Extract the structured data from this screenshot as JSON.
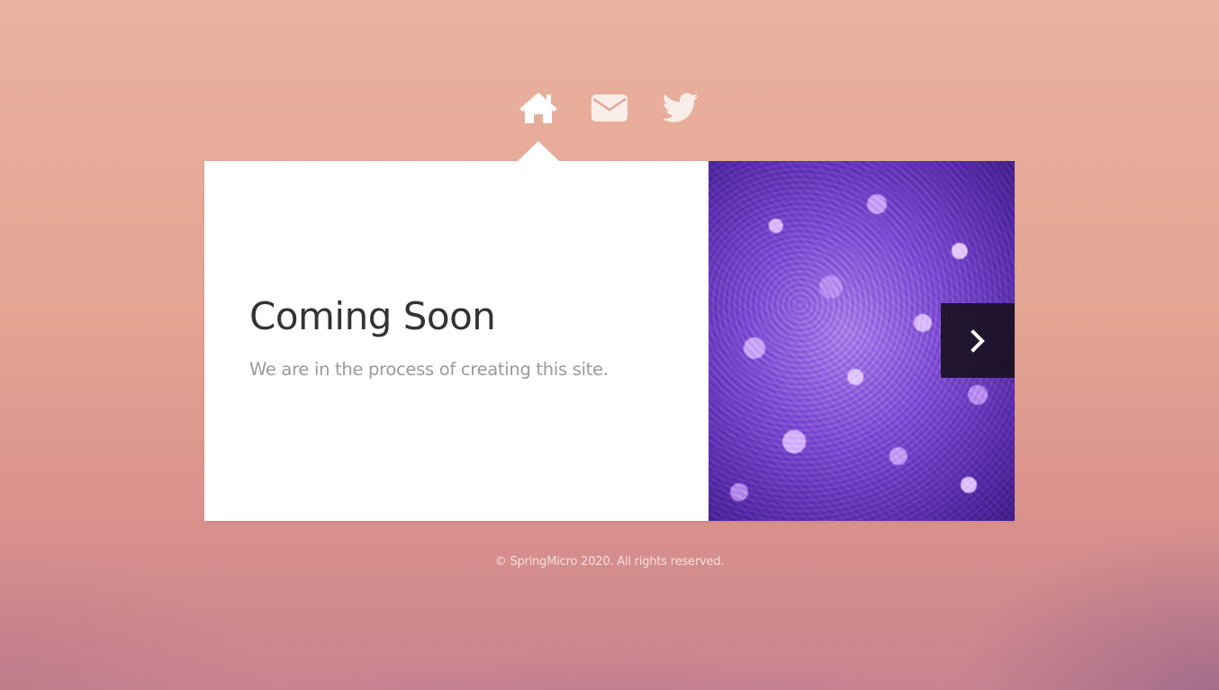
{
  "nav": {
    "items": [
      {
        "icon": "home-icon",
        "active": true
      },
      {
        "icon": "envelope-icon",
        "active": false
      },
      {
        "icon": "twitter-icon",
        "active": false
      }
    ]
  },
  "content": {
    "title": "Coming Soon",
    "subtitle": "We are in the process of creating this site."
  },
  "slideshow": {
    "next_icon": "chevron-right-icon"
  },
  "footer": {
    "copyright": "© SpringMicro 2020. All rights reserved."
  },
  "colors": {
    "background_top": "#e9b29f",
    "background_bottom": "#c98490",
    "panel_bg": "#ffffff",
    "title_color": "#333333",
    "subtitle_color": "#9a9a9a",
    "icon_color": "#ffffff",
    "image_accent": "#7d4fd1"
  }
}
